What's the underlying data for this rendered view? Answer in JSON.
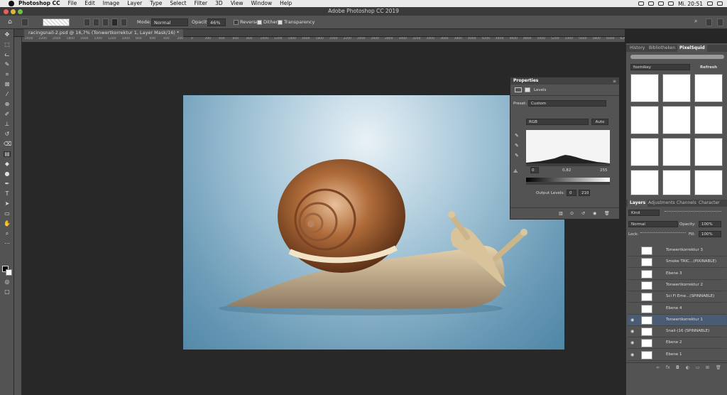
{
  "menubar": {
    "app": "Photoshop CC",
    "items": [
      "File",
      "Edit",
      "Image",
      "Layer",
      "Type",
      "Select",
      "Filter",
      "3D",
      "View",
      "Window",
      "Help"
    ],
    "clock": "Mi. 20:51"
  },
  "window": {
    "title": "Adobe Photoshop CC 2019"
  },
  "options": {
    "mode_label": "Mode:",
    "mode_value": "Normal",
    "opacity_label": "Opacity:",
    "opacity_value": "46%",
    "reverse_label": "Reverse",
    "dither_label": "Dither",
    "transparency_label": "Transparency"
  },
  "document": {
    "tab_title": "racingsnail-2.psd @ 16,7% (Tonwertkorrektur 1, Layer Mask/16) *",
    "ruler_ticks": [
      "2400",
      "2200",
      "2000",
      "1800",
      "1600",
      "1400",
      "1200",
      "1000",
      "800",
      "600",
      "400",
      "200",
      "0",
      "200",
      "400",
      "600",
      "800",
      "1000",
      "1200",
      "1400",
      "1600",
      "1800",
      "2000",
      "2200",
      "2400",
      "2600",
      "2800",
      "3000",
      "3200",
      "3400",
      "3600",
      "3800",
      "4000",
      "4200",
      "4400",
      "4600",
      "4800",
      "5000",
      "5200",
      "5400",
      "5600",
      "5800",
      "6000",
      "6200"
    ]
  },
  "panels": {
    "top_tabs": [
      "History",
      "Bibliotheken",
      "PixelSquid"
    ],
    "search_value": "foxmikey",
    "refresh_label": "Refresh",
    "layer_tabs": [
      "Layers",
      "Adjustments",
      "Channels",
      "Character"
    ],
    "kind_label": "Kind",
    "blend_mode": "Normal",
    "opacity_label": "Opacity:",
    "opacity_value": "100%",
    "lock_label": "Lock:",
    "fill_label": "Fill:",
    "fill_value": "100%",
    "layers": [
      {
        "name": "Tonwertkorrektur 3",
        "visible": false,
        "selected": false
      },
      {
        "name": "Smoke TRIC...(PIXINABLE)",
        "visible": false,
        "selected": false
      },
      {
        "name": "Ebene 3",
        "visible": false,
        "selected": false
      },
      {
        "name": "Tonwertkorrektur 2",
        "visible": false,
        "selected": false
      },
      {
        "name": "Sci Fi Eme...(SPINNABLE)",
        "visible": false,
        "selected": false
      },
      {
        "name": "Ebene 4",
        "visible": false,
        "selected": false
      },
      {
        "name": "Tonwertkorrektur 1",
        "visible": true,
        "selected": true
      },
      {
        "name": "Snail-(16 (SPINNABLE)",
        "visible": true,
        "selected": false
      },
      {
        "name": "Ebene 2",
        "visible": true,
        "selected": false
      },
      {
        "name": "Ebene 1",
        "visible": true,
        "selected": false
      }
    ]
  },
  "properties": {
    "title": "Properties",
    "subtitle": "Levels",
    "preset_label": "Preset:",
    "preset_value": "Custom",
    "channel_value": "RGB",
    "auto_label": "Auto",
    "input_low": "0",
    "input_mid": "0,82",
    "input_high": "255",
    "output_label": "Output Levels:",
    "output_low": "0",
    "output_high": "210"
  },
  "colors": {
    "accent": "#4a5b74",
    "panel": "#535353",
    "dark": "#262626"
  }
}
